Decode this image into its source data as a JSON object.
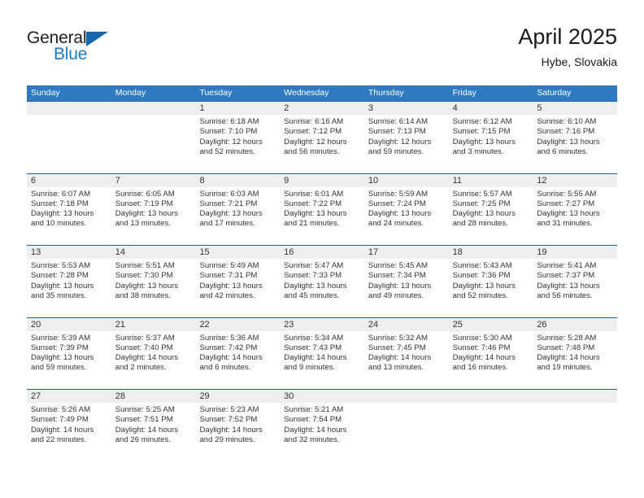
{
  "brand": {
    "name_top": "General",
    "name_bottom": "Blue",
    "accent_color": "#1b7ac4",
    "triangle_color": "#1566ad"
  },
  "header": {
    "title": "April 2025",
    "subtitle": "Hybe, Slovakia"
  },
  "theme": {
    "header_band": "#2f7ac0",
    "row_divider": "#1f62a8",
    "day_number_band": "#eeeeee",
    "text": "#333333"
  },
  "weekdays": [
    "Sunday",
    "Monday",
    "Tuesday",
    "Wednesday",
    "Thursday",
    "Friday",
    "Saturday"
  ],
  "weeks": [
    [
      {
        "day": "",
        "lines": []
      },
      {
        "day": "",
        "lines": []
      },
      {
        "day": "1",
        "lines": [
          "Sunrise: 6:18 AM",
          "Sunset: 7:10 PM",
          "Daylight: 12 hours",
          "and 52 minutes."
        ]
      },
      {
        "day": "2",
        "lines": [
          "Sunrise: 6:16 AM",
          "Sunset: 7:12 PM",
          "Daylight: 12 hours",
          "and 56 minutes."
        ]
      },
      {
        "day": "3",
        "lines": [
          "Sunrise: 6:14 AM",
          "Sunset: 7:13 PM",
          "Daylight: 12 hours",
          "and 59 minutes."
        ]
      },
      {
        "day": "4",
        "lines": [
          "Sunrise: 6:12 AM",
          "Sunset: 7:15 PM",
          "Daylight: 13 hours",
          "and 3 minutes."
        ]
      },
      {
        "day": "5",
        "lines": [
          "Sunrise: 6:10 AM",
          "Sunset: 7:16 PM",
          "Daylight: 13 hours",
          "and 6 minutes."
        ]
      }
    ],
    [
      {
        "day": "6",
        "lines": [
          "Sunrise: 6:07 AM",
          "Sunset: 7:18 PM",
          "Daylight: 13 hours",
          "and 10 minutes."
        ]
      },
      {
        "day": "7",
        "lines": [
          "Sunrise: 6:05 AM",
          "Sunset: 7:19 PM",
          "Daylight: 13 hours",
          "and 13 minutes."
        ]
      },
      {
        "day": "8",
        "lines": [
          "Sunrise: 6:03 AM",
          "Sunset: 7:21 PM",
          "Daylight: 13 hours",
          "and 17 minutes."
        ]
      },
      {
        "day": "9",
        "lines": [
          "Sunrise: 6:01 AM",
          "Sunset: 7:22 PM",
          "Daylight: 13 hours",
          "and 21 minutes."
        ]
      },
      {
        "day": "10",
        "lines": [
          "Sunrise: 5:59 AM",
          "Sunset: 7:24 PM",
          "Daylight: 13 hours",
          "and 24 minutes."
        ]
      },
      {
        "day": "11",
        "lines": [
          "Sunrise: 5:57 AM",
          "Sunset: 7:25 PM",
          "Daylight: 13 hours",
          "and 28 minutes."
        ]
      },
      {
        "day": "12",
        "lines": [
          "Sunrise: 5:55 AM",
          "Sunset: 7:27 PM",
          "Daylight: 13 hours",
          "and 31 minutes."
        ]
      }
    ],
    [
      {
        "day": "13",
        "lines": [
          "Sunrise: 5:53 AM",
          "Sunset: 7:28 PM",
          "Daylight: 13 hours",
          "and 35 minutes."
        ]
      },
      {
        "day": "14",
        "lines": [
          "Sunrise: 5:51 AM",
          "Sunset: 7:30 PM",
          "Daylight: 13 hours",
          "and 38 minutes."
        ]
      },
      {
        "day": "15",
        "lines": [
          "Sunrise: 5:49 AM",
          "Sunset: 7:31 PM",
          "Daylight: 13 hours",
          "and 42 minutes."
        ]
      },
      {
        "day": "16",
        "lines": [
          "Sunrise: 5:47 AM",
          "Sunset: 7:33 PM",
          "Daylight: 13 hours",
          "and 45 minutes."
        ]
      },
      {
        "day": "17",
        "lines": [
          "Sunrise: 5:45 AM",
          "Sunset: 7:34 PM",
          "Daylight: 13 hours",
          "and 49 minutes."
        ]
      },
      {
        "day": "18",
        "lines": [
          "Sunrise: 5:43 AM",
          "Sunset: 7:36 PM",
          "Daylight: 13 hours",
          "and 52 minutes."
        ]
      },
      {
        "day": "19",
        "lines": [
          "Sunrise: 5:41 AM",
          "Sunset: 7:37 PM",
          "Daylight: 13 hours",
          "and 56 minutes."
        ]
      }
    ],
    [
      {
        "day": "20",
        "lines": [
          "Sunrise: 5:39 AM",
          "Sunset: 7:39 PM",
          "Daylight: 13 hours",
          "and 59 minutes."
        ]
      },
      {
        "day": "21",
        "lines": [
          "Sunrise: 5:37 AM",
          "Sunset: 7:40 PM",
          "Daylight: 14 hours",
          "and 2 minutes."
        ]
      },
      {
        "day": "22",
        "lines": [
          "Sunrise: 5:36 AM",
          "Sunset: 7:42 PM",
          "Daylight: 14 hours",
          "and 6 minutes."
        ]
      },
      {
        "day": "23",
        "lines": [
          "Sunrise: 5:34 AM",
          "Sunset: 7:43 PM",
          "Daylight: 14 hours",
          "and 9 minutes."
        ]
      },
      {
        "day": "24",
        "lines": [
          "Sunrise: 5:32 AM",
          "Sunset: 7:45 PM",
          "Daylight: 14 hours",
          "and 13 minutes."
        ]
      },
      {
        "day": "25",
        "lines": [
          "Sunrise: 5:30 AM",
          "Sunset: 7:46 PM",
          "Daylight: 14 hours",
          "and 16 minutes."
        ]
      },
      {
        "day": "26",
        "lines": [
          "Sunrise: 5:28 AM",
          "Sunset: 7:48 PM",
          "Daylight: 14 hours",
          "and 19 minutes."
        ]
      }
    ],
    [
      {
        "day": "27",
        "lines": [
          "Sunrise: 5:26 AM",
          "Sunset: 7:49 PM",
          "Daylight: 14 hours",
          "and 22 minutes."
        ]
      },
      {
        "day": "28",
        "lines": [
          "Sunrise: 5:25 AM",
          "Sunset: 7:51 PM",
          "Daylight: 14 hours",
          "and 26 minutes."
        ]
      },
      {
        "day": "29",
        "lines": [
          "Sunrise: 5:23 AM",
          "Sunset: 7:52 PM",
          "Daylight: 14 hours",
          "and 29 minutes."
        ]
      },
      {
        "day": "30",
        "lines": [
          "Sunrise: 5:21 AM",
          "Sunset: 7:54 PM",
          "Daylight: 14 hours",
          "and 32 minutes."
        ]
      },
      {
        "day": "",
        "lines": []
      },
      {
        "day": "",
        "lines": []
      },
      {
        "day": "",
        "lines": []
      }
    ]
  ]
}
